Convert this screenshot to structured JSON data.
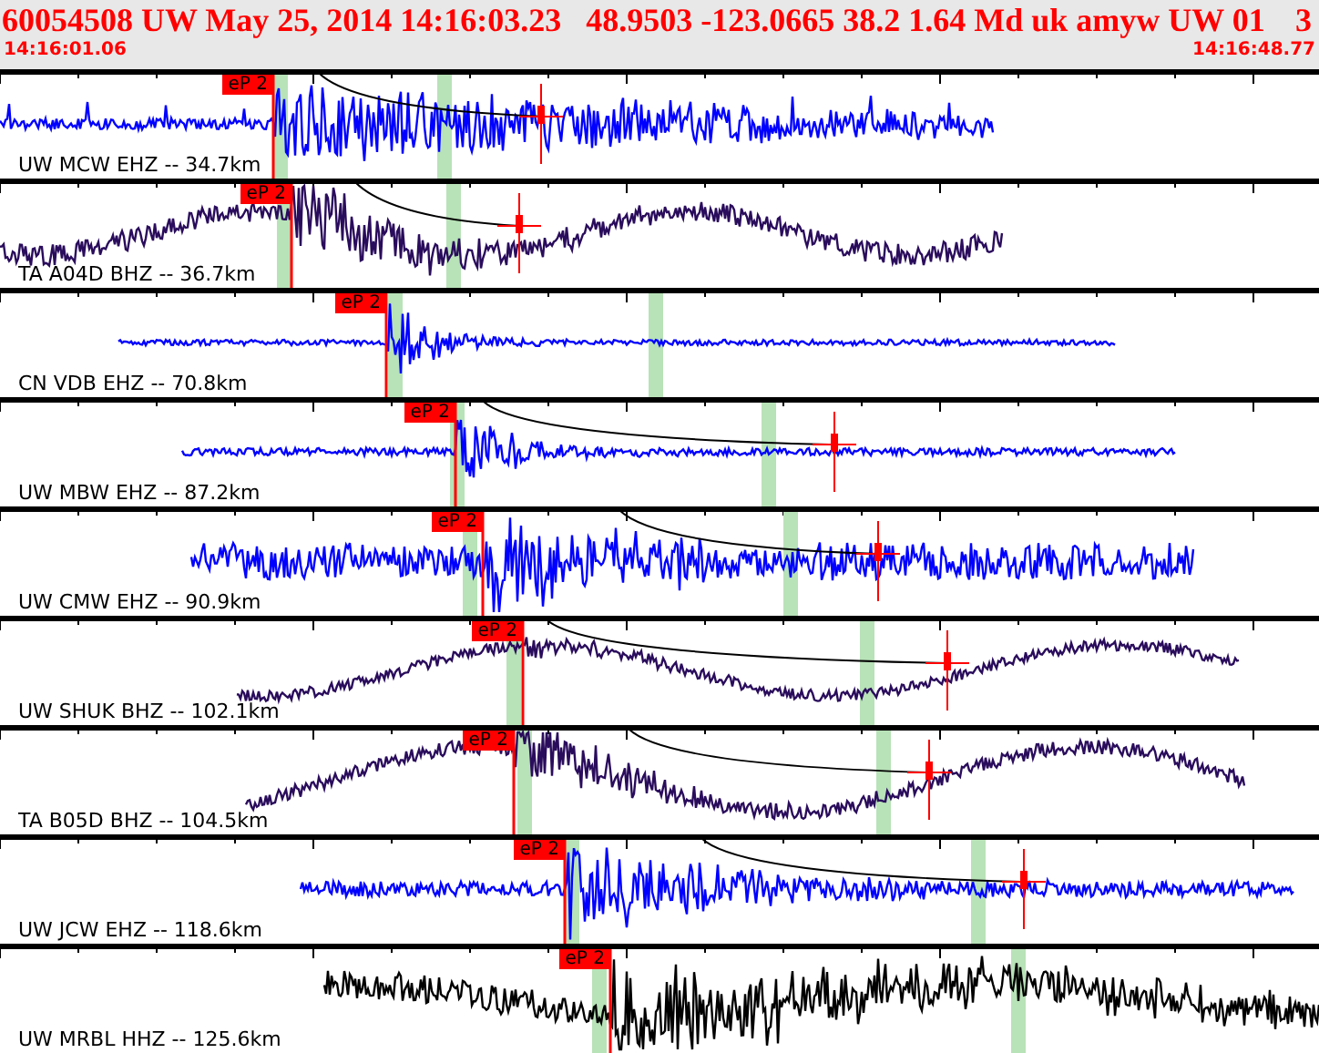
{
  "header": {
    "title": "60054508 UW May 25, 2014 14:16:03.23   48.9503 -123.0665 38.2 1.64 Md uk amyw UW 01",
    "trailing": "3",
    "start_time": "14:16:01.06",
    "end_time": "14:16:48.77"
  },
  "traces": [
    {
      "label": "UW MCW EHZ -- 34.7km",
      "color": "#0000ff",
      "pick": "eP 2"
    },
    {
      "label": "TA A04D BHZ -- 36.7km",
      "color": "#2a0c5c",
      "pick": "eP 2"
    },
    {
      "label": "CN VDB EHZ -- 70.8km",
      "color": "#0000ff",
      "pick": "eP 2"
    },
    {
      "label": "UW MBW EHZ -- 87.2km",
      "color": "#0000ff",
      "pick": "eP 2"
    },
    {
      "label": "UW CMW EHZ -- 90.9km",
      "color": "#0000ff",
      "pick": "eP 2"
    },
    {
      "label": "UW SHUK BHZ -- 102.1km",
      "color": "#2a0c5c",
      "pick": "eP 2"
    },
    {
      "label": "TA B05D BHZ -- 104.5km",
      "color": "#2a0c5c",
      "pick": "eP 2"
    },
    {
      "label": "UW JCW EHZ -- 118.6km",
      "color": "#0000ff",
      "pick": "eP 2"
    },
    {
      "label": "UW MRBL HHZ -- 125.6km",
      "color": "#000000",
      "pick": "eP 2"
    }
  ]
}
